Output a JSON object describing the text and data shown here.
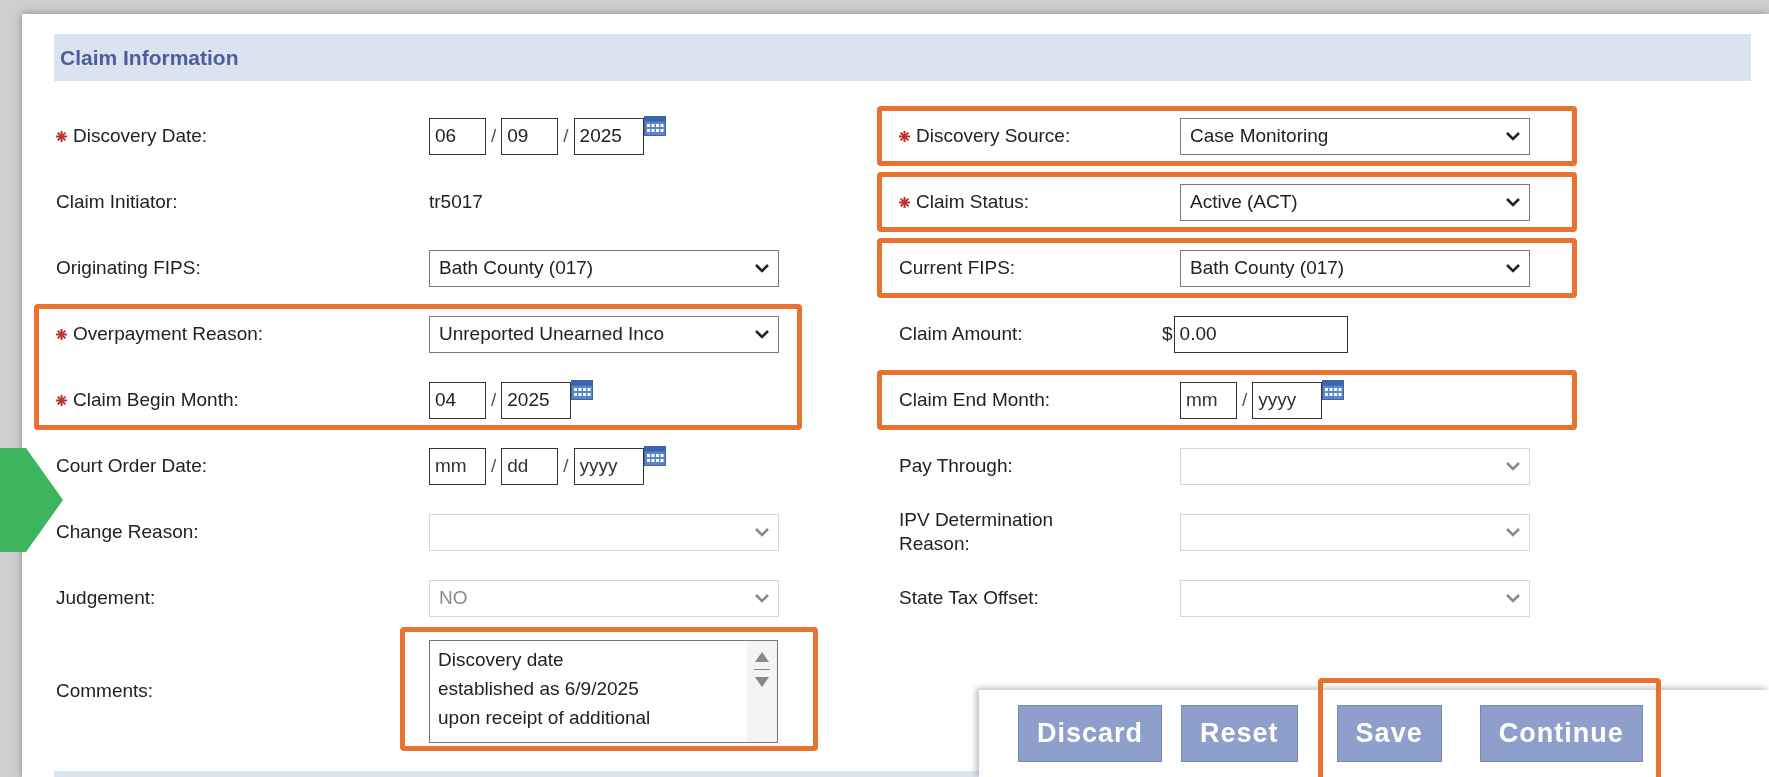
{
  "section": {
    "title": "Claim Information"
  },
  "columns": [
    {
      "groups": [
        {
          "highlighted": false,
          "fields": [
            {
              "kind": "date",
              "label": "Discovery Date:",
              "required": true,
              "highlighted": false,
              "parts": [
                {
                  "value": "06"
                },
                {
                  "value": "09"
                },
                {
                  "value": "2025"
                }
              ],
              "separators": [
                "/",
                "/"
              ]
            }
          ]
        },
        {
          "highlighted": false,
          "fields": [
            {
              "kind": "text",
              "label": "Claim Initiator:",
              "required": false,
              "highlighted": false,
              "value": "tr5017"
            }
          ]
        },
        {
          "highlighted": false,
          "fields": [
            {
              "kind": "select",
              "label": "Originating FIPS:",
              "required": false,
              "highlighted": false,
              "disabled": false,
              "value": "Bath County (017)"
            }
          ]
        },
        {
          "highlighted": true,
          "fields": [
            {
              "kind": "select",
              "label": "Overpayment Reason:",
              "required": true,
              "highlighted": false,
              "disabled": false,
              "value": "Unreported Unearned Inco"
            },
            {
              "kind": "date",
              "label": "Claim Begin Month:",
              "required": true,
              "highlighted": false,
              "parts": [
                {
                  "value": "04"
                },
                {
                  "value": "2025"
                }
              ],
              "separators": [
                "/"
              ]
            }
          ]
        },
        {
          "highlighted": false,
          "fields": [
            {
              "kind": "date",
              "label": "Court Order Date:",
              "required": false,
              "highlighted": false,
              "parts": [
                {
                  "placeholder": "mm"
                },
                {
                  "placeholder": "dd"
                },
                {
                  "placeholder": "yyyy"
                }
              ],
              "separators": [
                "/",
                "/"
              ]
            }
          ]
        },
        {
          "highlighted": false,
          "fields": [
            {
              "kind": "select",
              "label": "Change Reason:",
              "required": false,
              "highlighted": false,
              "disabled": true
            }
          ]
        },
        {
          "highlighted": false,
          "fields": [
            {
              "kind": "select",
              "label": "Judgement:",
              "required": false,
              "highlighted": false,
              "disabled": true,
              "value": "NO"
            }
          ]
        },
        {
          "highlighted": false,
          "fields": [
            {
              "kind": "textarea",
              "label": "Comments:",
              "required": false,
              "highlighted": true,
              "lines": [
                "Discovery date",
                "established as 6/9/2025",
                "upon receipt of additional"
              ]
            }
          ]
        }
      ]
    },
    {
      "groups": [
        {
          "highlighted": true,
          "fields": [
            {
              "kind": "select",
              "label": "Discovery Source:",
              "required": true,
              "highlighted": false,
              "disabled": false,
              "value": "Case Monitoring"
            }
          ]
        },
        {
          "highlighted": true,
          "fields": [
            {
              "kind": "select",
              "label": "Claim Status:",
              "required": true,
              "highlighted": false,
              "disabled": false,
              "value": "Active (ACT)"
            }
          ]
        },
        {
          "highlighted": true,
          "fields": [
            {
              "kind": "select",
              "label": "Current FIPS:",
              "required": false,
              "highlighted": false,
              "disabled": false,
              "value": "Bath County (017)"
            }
          ]
        },
        {
          "highlighted": false,
          "fields": [
            {
              "kind": "money",
              "label": "Claim Amount:",
              "required": false,
              "highlighted": false,
              "prefix": "$",
              "value": "0.00"
            }
          ]
        },
        {
          "highlighted": true,
          "fields": [
            {
              "kind": "date",
              "label": "Claim End Month:",
              "required": false,
              "highlighted": false,
              "parts": [
                {
                  "placeholder": "mm"
                },
                {
                  "placeholder": "yyyy"
                }
              ],
              "separators": [
                "/"
              ]
            }
          ]
        },
        {
          "highlighted": false,
          "fields": [
            {
              "kind": "select",
              "label": "Pay Through:",
              "required": false,
              "highlighted": false,
              "disabled": true
            }
          ]
        },
        {
          "highlighted": false,
          "fields": [
            {
              "kind": "select",
              "label": "IPV Determination Reason:",
              "required": false,
              "highlighted": false,
              "disabled": true
            }
          ]
        },
        {
          "highlighted": false,
          "fields": [
            {
              "kind": "select",
              "label": "State Tax Offset:",
              "required": false,
              "highlighted": false,
              "disabled": true
            }
          ]
        }
      ]
    }
  ],
  "actions": [
    {
      "highlighted": false,
      "buttons": [
        {
          "label": "Discard"
        },
        {
          "label": "Reset"
        }
      ]
    },
    {
      "highlighted": true,
      "buttons": [
        {
          "label": "Save"
        },
        {
          "label": "Continue"
        }
      ]
    }
  ]
}
